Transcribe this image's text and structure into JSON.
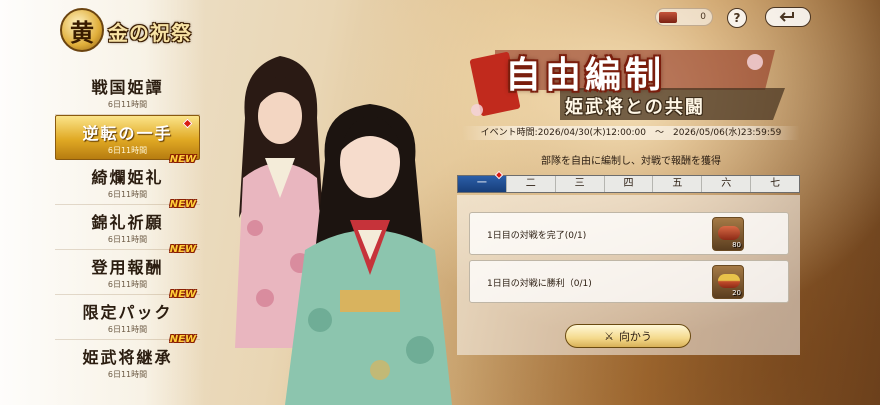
{
  "event": {
    "badge": "黄",
    "title": "金の祝祭"
  },
  "menu": [
    {
      "title": "戦国姫譚",
      "sub": "6日11時間",
      "new": ""
    },
    {
      "title": "逆転の一手",
      "sub": "6日11時間",
      "new": ""
    },
    {
      "title": "綺爛姫礼",
      "sub": "6日11時間",
      "new": "NEW"
    },
    {
      "title": "錦礼祈願",
      "sub": "6日11時間",
      "new": "NEW"
    },
    {
      "title": "登用報酬",
      "sub": "6日11時間",
      "new": "NEW"
    },
    {
      "title": "限定パック",
      "sub": "6日11時間",
      "new": "NEW"
    },
    {
      "title": "姫武将継承",
      "sub": "6日11時間",
      "new": "NEW"
    }
  ],
  "topbar": {
    "currency": "0",
    "help": "?"
  },
  "title": {
    "main": "自由編制",
    "sub": "姫武将との共闘",
    "time": "イベント時間:2026/04/30(木)12:00:00　～　2026/05/06(水)23:59:59",
    "desc": "部隊を自由に編制し、対戦で報酬を獲得"
  },
  "tabs": [
    "一",
    "二",
    "三",
    "四",
    "五",
    "六",
    "七"
  ],
  "missions": [
    {
      "text": "1日目の対戦を完了(0/1)",
      "reward_count": "80"
    },
    {
      "text": "1日目の対戦に勝利（0/1)",
      "reward_count": "20"
    }
  ],
  "go_button": {
    "label": "向かう",
    "icon": "⚔"
  },
  "colors": {
    "accent": "#1b4a8f",
    "gold": "#e0a924",
    "red": "#d81c14"
  }
}
